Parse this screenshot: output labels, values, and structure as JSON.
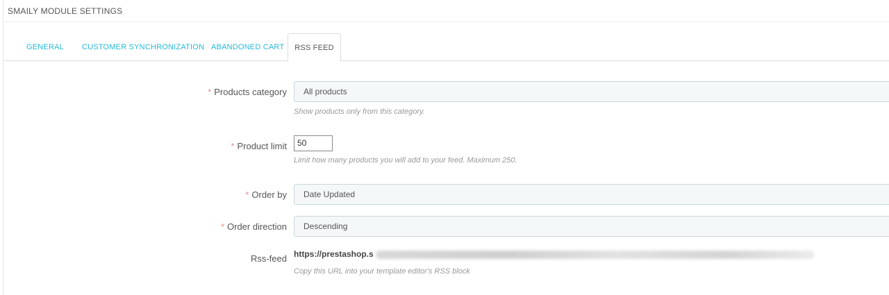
{
  "panel": {
    "title": "SMAILY MODULE SETTINGS"
  },
  "tabs": [
    {
      "label": "GENERAL"
    },
    {
      "label": "CUSTOMER SYNCHRONIZATION"
    },
    {
      "label": "ABANDONED CART"
    },
    {
      "label": "RSS FEED"
    }
  ],
  "form": {
    "required_mark": "*",
    "products_category": {
      "label": "Products category",
      "value": "All products",
      "help": "Show products only from this category."
    },
    "product_limit": {
      "label": "Product limit",
      "value": "50",
      "help": "Limit how many products you will add to your feed. Maximum 250."
    },
    "order_by": {
      "label": "Order by",
      "value": "Date Updated"
    },
    "order_direction": {
      "label": "Order direction",
      "value": "Descending"
    },
    "rss_feed": {
      "label": "Rss-feed",
      "url_visible": "https://prestashop.s",
      "help": "Copy this URL into your template editor's RSS block"
    }
  }
}
